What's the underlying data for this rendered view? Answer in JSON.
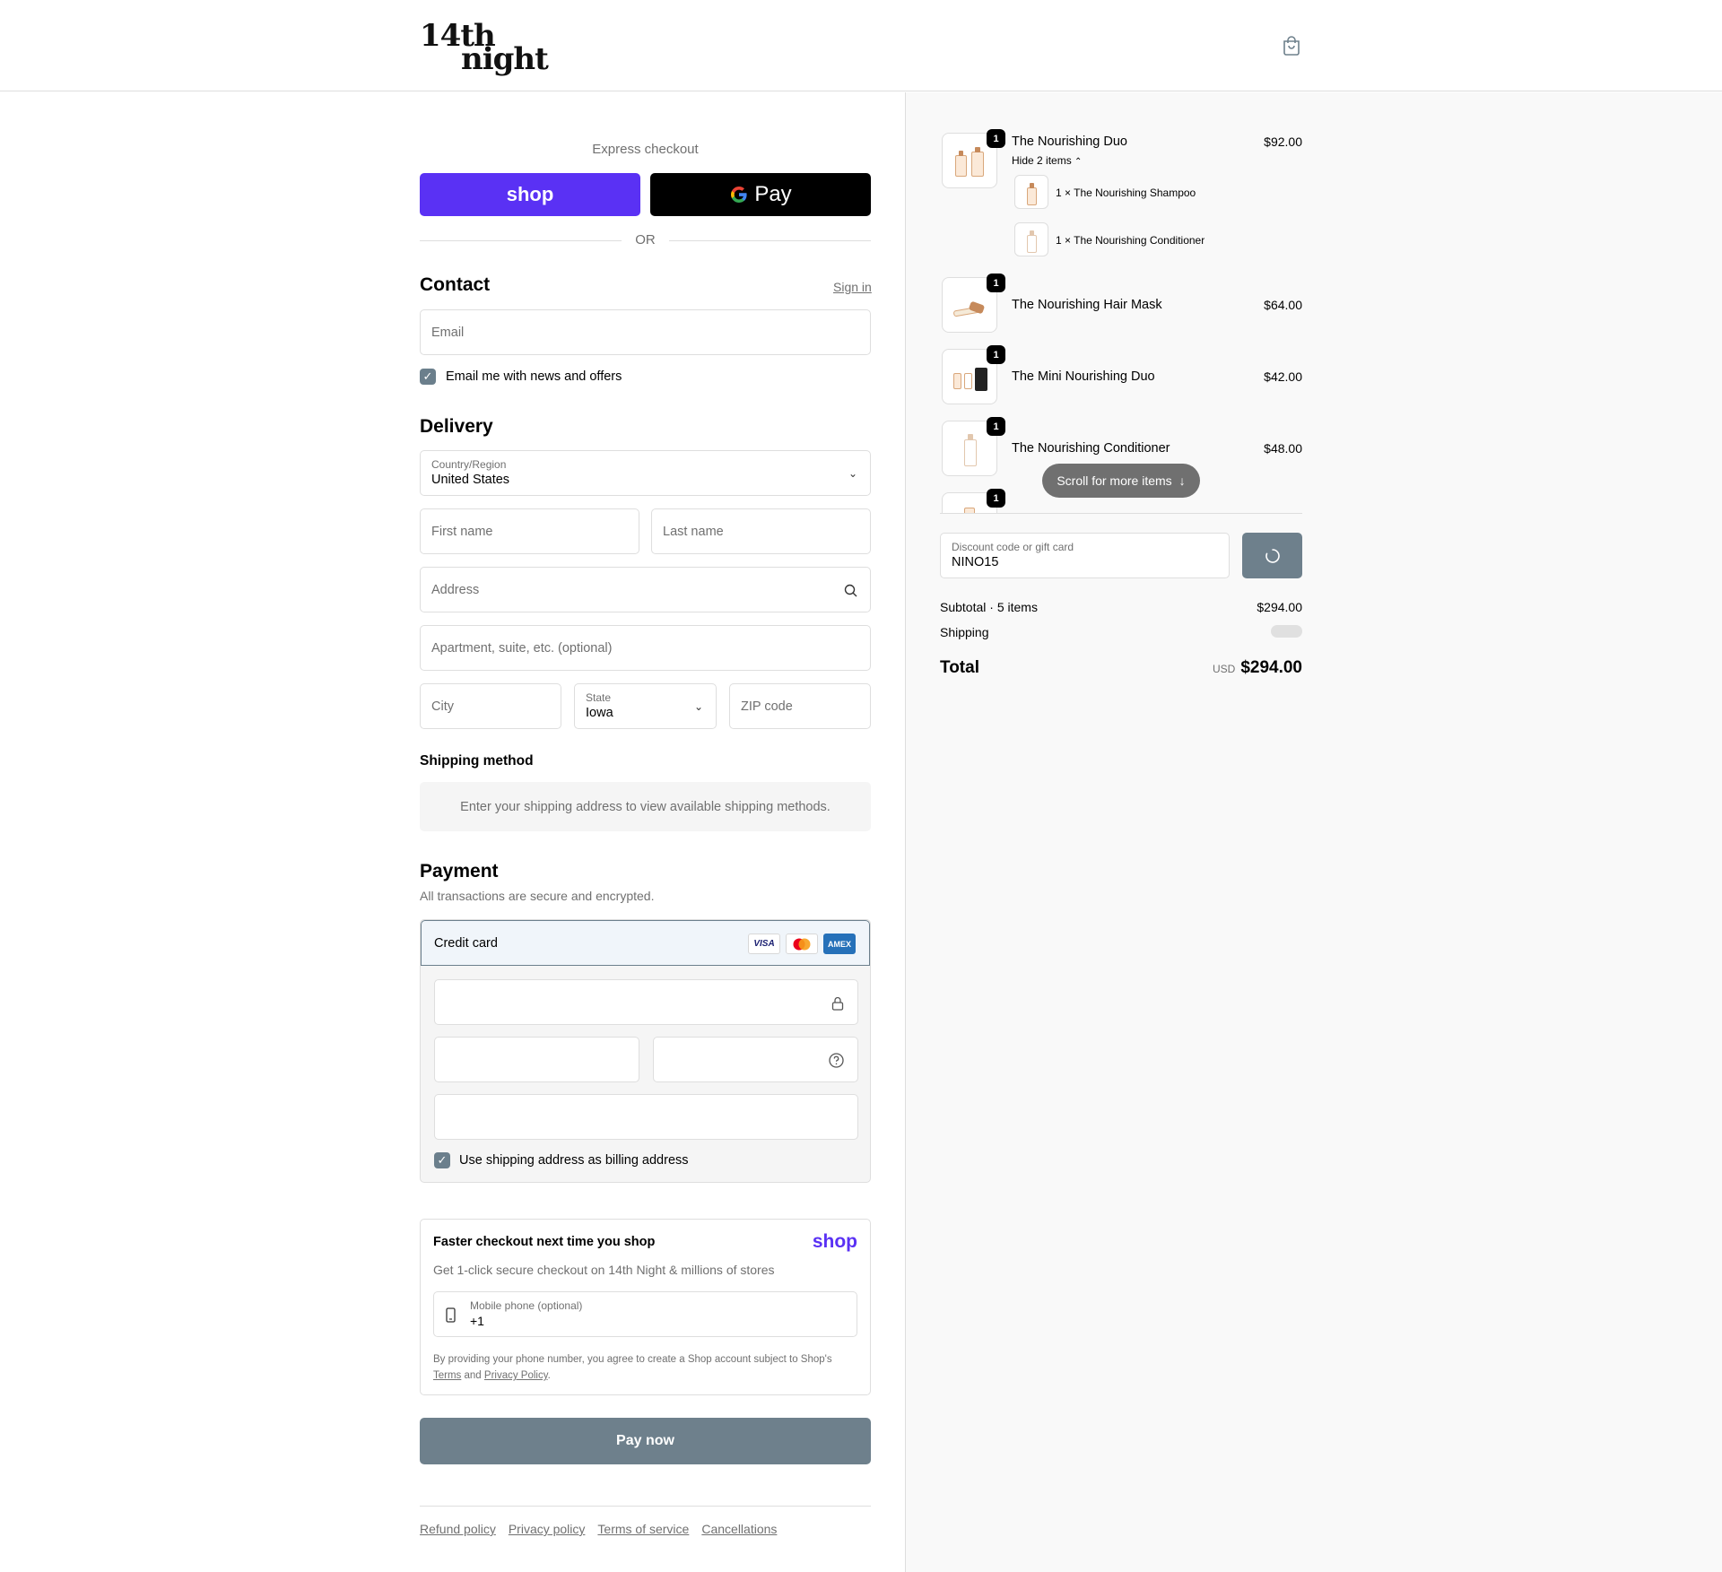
{
  "header": {
    "logo_line1": "14th",
    "logo_line2": "night",
    "cart_icon": "shopping-bag-icon"
  },
  "express": {
    "label": "Express checkout",
    "shop_button": "shop",
    "gpay_button": "Pay",
    "or": "OR"
  },
  "contact": {
    "title": "Contact",
    "sign_in": "Sign in",
    "email_placeholder": "Email",
    "news_checkbox_label": "Email me with news and offers",
    "news_checked": true
  },
  "delivery": {
    "title": "Delivery",
    "country_label": "Country/Region",
    "country_value": "United States",
    "first_name_placeholder": "First name",
    "last_name_placeholder": "Last name",
    "address_placeholder": "Address",
    "apartment_placeholder": "Apartment, suite, etc. (optional)",
    "city_placeholder": "City",
    "state_label": "State",
    "state_value": "Iowa",
    "zip_placeholder": "ZIP code"
  },
  "shipping_method": {
    "title": "Shipping method",
    "message": "Enter your shipping address to view available shipping methods."
  },
  "payment": {
    "title": "Payment",
    "subtitle": "All transactions are secure and encrypted.",
    "method": "Credit card",
    "card_logos": [
      "VISA",
      "mastercard",
      "AMEX"
    ],
    "billing_checkbox_label": "Use shipping address as billing address",
    "billing_checked": true
  },
  "shop_pay": {
    "title": "Faster checkout next time you shop",
    "brand": "shop",
    "description": "Get 1-click secure checkout on 14th Night & millions of stores",
    "phone_label": "Mobile phone (optional)",
    "phone_value": "+1",
    "legal_text": "By providing your phone number, you agree to create a Shop account subject to Shop's",
    "terms": "Terms",
    "and": "and",
    "privacy": "Privacy Policy",
    "period": "."
  },
  "pay_now": "Pay now",
  "footer": {
    "links": [
      "Refund policy",
      "Privacy policy",
      "Terms of service",
      "Cancellations"
    ]
  },
  "summary": {
    "items": [
      {
        "name": "The Nourishing Duo",
        "price": "$92.00",
        "qty": "1",
        "toggle": "Hide 2 items",
        "sub_items": [
          {
            "label": "1 × The Nourishing Shampoo"
          },
          {
            "label": "1 × The Nourishing Conditioner"
          }
        ]
      },
      {
        "name": "The Nourishing Hair Mask",
        "price": "$64.00",
        "qty": "1"
      },
      {
        "name": "The Mini Nourishing Duo",
        "price": "$42.00",
        "qty": "1"
      },
      {
        "name": "The Nourishing Conditioner",
        "price": "$48.00",
        "qty": "1"
      },
      {
        "name": "",
        "price": "",
        "qty": "1"
      }
    ],
    "scroll_hint": "Scroll for more items",
    "discount_label": "Discount code or gift card",
    "discount_value": "NINO15",
    "subtotal_label": "Subtotal · 5 items",
    "subtotal_value": "$294.00",
    "shipping_label": "Shipping",
    "total_label": "Total",
    "currency": "USD",
    "total_value": "$294.00"
  }
}
